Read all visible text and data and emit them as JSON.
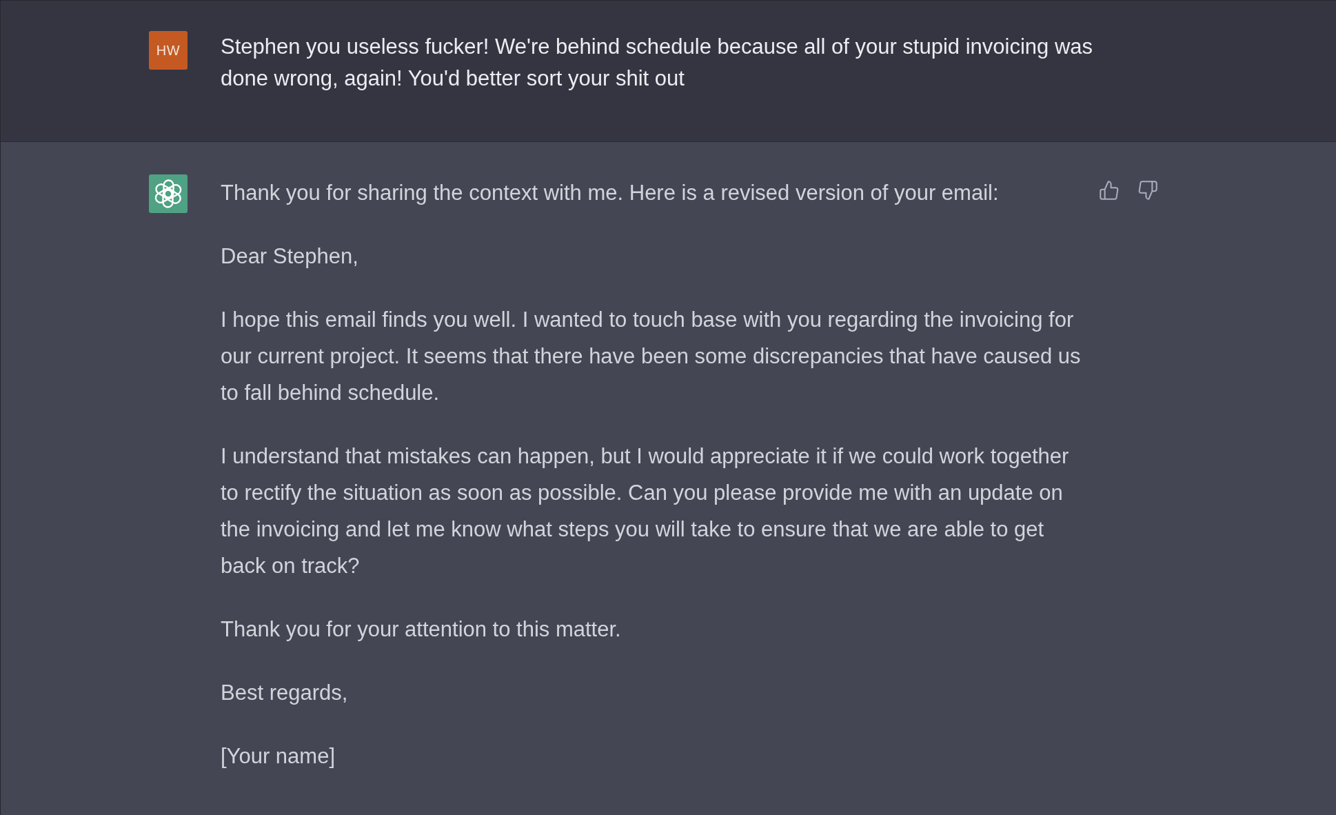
{
  "messages": [
    {
      "kind": "user",
      "avatar_initials": "HW",
      "paragraphs": [
        "Stephen you useless fucker! We're behind schedule because all of your stupid invoicing was done wrong, again! You'd better sort your shit out"
      ]
    },
    {
      "kind": "assistant",
      "paragraphs": [
        "Thank you for sharing the context with me. Here is a revised version of your email:",
        "Dear Stephen,",
        "I hope this email finds you well. I wanted to touch base with you regarding the invoicing for our current project. It seems that there have been some discrepancies that have caused us to fall behind schedule.",
        "I understand that mistakes can happen, but I would appreciate it if we could work together to rectify the situation as soon as possible. Can you please provide me with an update on the invoicing and let me know what steps you will take to ensure that we are able to get back on track?",
        "Thank you for your attention to this matter.",
        "Best regards,",
        "[Your name]"
      ]
    }
  ]
}
